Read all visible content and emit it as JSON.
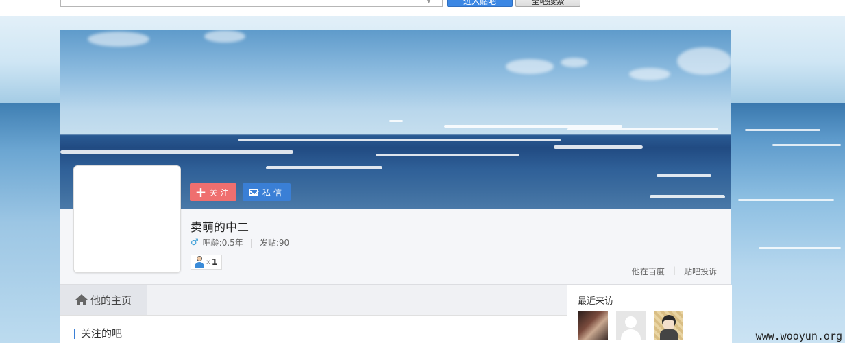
{
  "topbar": {
    "search_placeholder": "",
    "primary_button": "进入贴吧",
    "secondary_button": "全吧搜索"
  },
  "profile": {
    "follow_label": "关注",
    "message_label": "私信",
    "username": "卖萌的中二",
    "age": "吧龄:0.5年",
    "posts": "发贴:90",
    "badge_multiplier": "x",
    "badge_count": "1",
    "links": [
      "他在百度",
      "贴吧投诉"
    ]
  },
  "tabs": {
    "home": "他的主页"
  },
  "main": {
    "section_title": "关注的吧"
  },
  "sidebar": {
    "title": "最近来访"
  },
  "watermark": "www.wooyun.org",
  "colors": {
    "follow": "#ef6f6f",
    "message": "#3a7fd6",
    "accent": "#3a7fd6"
  }
}
